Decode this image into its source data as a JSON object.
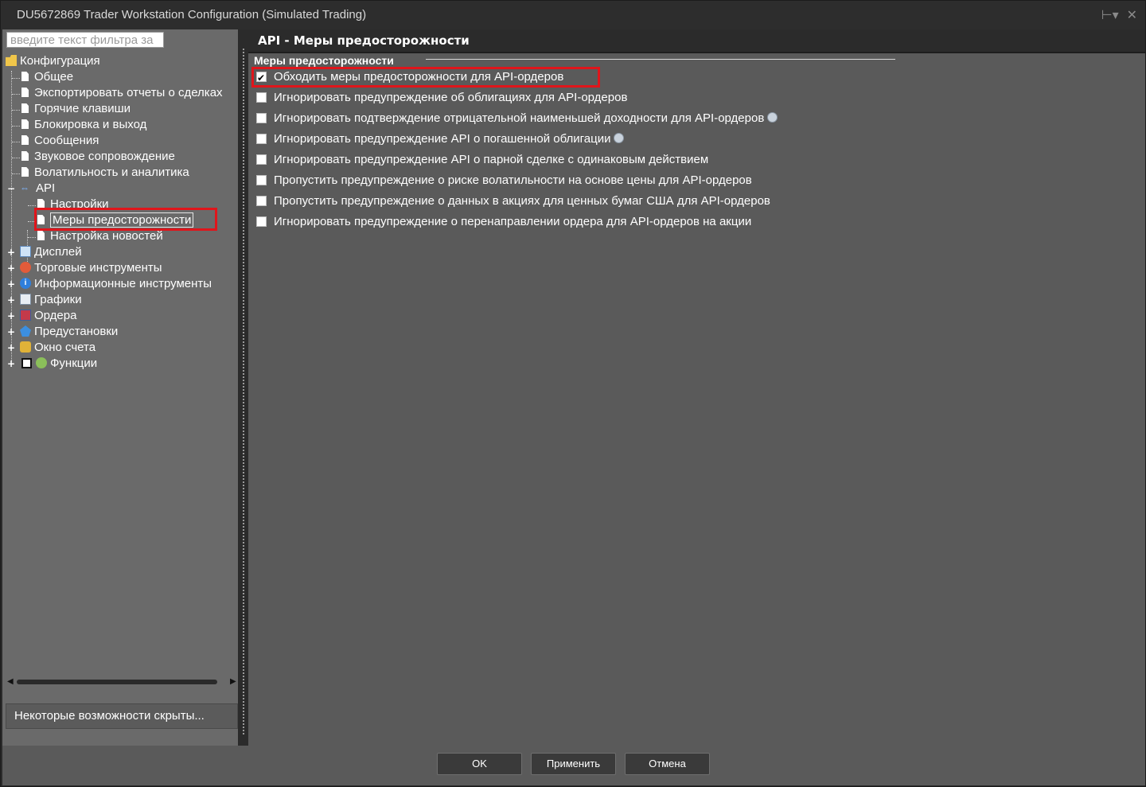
{
  "window": {
    "title": "DU5672869 Trader Workstation Configuration (Simulated Trading)"
  },
  "sidebar": {
    "filter_placeholder": "введите текст фильтра за",
    "root": "Конфигурация",
    "items": [
      {
        "label": "Общее"
      },
      {
        "label": "Экспортировать отчеты о сделках"
      },
      {
        "label": "Горячие клавиши"
      },
      {
        "label": "Блокировка и выход"
      },
      {
        "label": "Сообщения"
      },
      {
        "label": "Звуковое сопровождение"
      },
      {
        "label": "Волатильность и аналитика"
      },
      {
        "label": "API",
        "children": [
          {
            "label": "Настройки"
          },
          {
            "label": "Меры предосторожности"
          },
          {
            "label": "Настройка новостей"
          }
        ]
      },
      {
        "label": "Дисплей"
      },
      {
        "label": "Торговые инструменты"
      },
      {
        "label": "Информационные инструменты"
      },
      {
        "label": "Графики"
      },
      {
        "label": "Ордера"
      },
      {
        "label": "Предустановки"
      },
      {
        "label": "Окно счета"
      },
      {
        "label": "Функции"
      }
    ],
    "hidden_features_button": "Некоторые возможности скрыты..."
  },
  "main": {
    "header": "API - Меры предосторожности",
    "group_title": "Меры предосторожности",
    "options": [
      {
        "label": "Обходить меры предосторожности для API-ордеров",
        "checked": true
      },
      {
        "label": "Игнорировать предупреждение об облигациях для API-ордеров",
        "checked": false
      },
      {
        "label": "Игнорировать подтверждение отрицательной наименьшей доходности для API-ордеров",
        "checked": false
      },
      {
        "label": "Игнорировать предупреждение API о погашенной облигации",
        "checked": false
      },
      {
        "label": "Игнорировать предупреждение API о парной сделке с одинаковым действием",
        "checked": false
      },
      {
        "label": "Пропустить предупреждение о риске волатильности на основе цены для API-ордеров",
        "checked": false
      },
      {
        "label": "Пропустить предупреждение о данных в акциях для ценных бумаг США для API-ордеров",
        "checked": false
      },
      {
        "label": "Игнорировать предупреждение о перенаправлении ордера для API-ордеров на акции",
        "checked": false
      }
    ]
  },
  "footer": {
    "ok": "OK",
    "apply": "Применить",
    "cancel": "Отмена"
  },
  "colors": {
    "highlight_box": "#e0151b",
    "panel_bg": "#5a5a5a",
    "tree_bg": "#6a6a6a"
  }
}
